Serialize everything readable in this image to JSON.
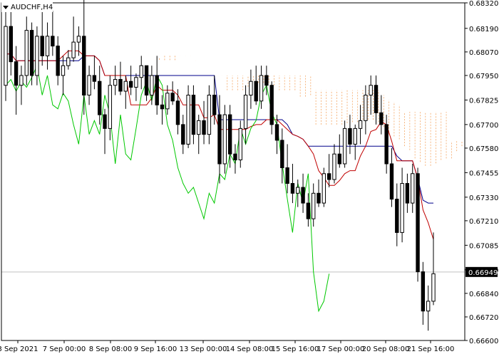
{
  "window": {
    "symbol_timeframe": "AUDCHF,H4"
  },
  "icons": {
    "symbol_menu": "triangle-down-icon"
  },
  "colors": {
    "background": "#ffffff",
    "frame": "#000000",
    "bull_candle": "#ffffff",
    "bear_candle": "#000000",
    "tenkan": "#c00000",
    "kijun": "#00008b",
    "chikou": "#00c800",
    "kumo_a": "#f4a460",
    "kumo_b": "#d8bfa0",
    "bid_line": "#c0c0c0",
    "price_tag_bg": "#000000",
    "price_tag_text": "#ffffff"
  },
  "price_tag": "0.66949",
  "chart_data": {
    "type": "candlestick",
    "title": "AUDCHF,H4",
    "ylim": [
      0.666,
      0.6832
    ],
    "y_ticks": [
      "0.68320",
      "0.68190",
      "0.68070",
      "0.67950",
      "0.67825",
      "0.67700",
      "0.67580",
      "0.67455",
      "0.67330",
      "0.67210",
      "0.67085",
      "0.66960",
      "0.66840",
      "0.66720",
      "0.66600"
    ],
    "x_ticks": [
      "3 Sep 2021",
      "7 Sep 00:00",
      "8 Sep 08:00",
      "9 Sep 16:00",
      "13 Sep 00:00",
      "14 Sep 08:00",
      "15 Sep 16:00",
      "17 Sep 00:00",
      "20 Sep 08:00",
      "21 Sep 16:00"
    ],
    "current_price": 0.66949,
    "candles": [
      [
        0.679,
        0.683,
        0.6782,
        0.682
      ],
      [
        0.682,
        0.6828,
        0.6795,
        0.6802
      ],
      [
        0.6802,
        0.681,
        0.6775,
        0.679
      ],
      [
        0.679,
        0.68,
        0.678,
        0.6795
      ],
      [
        0.6795,
        0.6825,
        0.679,
        0.6818
      ],
      [
        0.6818,
        0.6822,
        0.679,
        0.6795
      ],
      [
        0.6795,
        0.682,
        0.679,
        0.6815
      ],
      [
        0.6815,
        0.683,
        0.68,
        0.6805
      ],
      [
        0.6805,
        0.6822,
        0.6798,
        0.6815
      ],
      [
        0.6815,
        0.6828,
        0.6805,
        0.681
      ],
      [
        0.681,
        0.6815,
        0.679,
        0.6795
      ],
      [
        0.6795,
        0.6805,
        0.6785,
        0.68
      ],
      [
        0.68,
        0.6808,
        0.6798,
        0.6804
      ],
      [
        0.6804,
        0.6825,
        0.6802,
        0.6812
      ],
      [
        0.6812,
        0.682,
        0.6805,
        0.6815
      ],
      [
        0.6815,
        0.6835,
        0.6775,
        0.6785
      ],
      [
        0.6785,
        0.68,
        0.678,
        0.6795
      ],
      [
        0.6795,
        0.6805,
        0.6788,
        0.6792
      ],
      [
        0.6792,
        0.68,
        0.677,
        0.6775
      ],
      [
        0.6775,
        0.6778,
        0.6755,
        0.6768
      ],
      [
        0.6768,
        0.6795,
        0.6762,
        0.679
      ],
      [
        0.679,
        0.68,
        0.6785,
        0.6793
      ],
      [
        0.6793,
        0.6802,
        0.6785,
        0.6787
      ],
      [
        0.6787,
        0.6795,
        0.6778,
        0.6792
      ],
      [
        0.6792,
        0.68,
        0.6785,
        0.6789
      ],
      [
        0.6789,
        0.6796,
        0.6782,
        0.6794
      ],
      [
        0.6794,
        0.6805,
        0.6788,
        0.68
      ],
      [
        0.68,
        0.68,
        0.6782,
        0.6785
      ],
      [
        0.6785,
        0.68,
        0.678,
        0.6795
      ],
      [
        0.6795,
        0.6805,
        0.6775,
        0.678
      ],
      [
        0.678,
        0.6785,
        0.677,
        0.6778
      ],
      [
        0.6778,
        0.679,
        0.6775,
        0.6786
      ],
      [
        0.6786,
        0.6792,
        0.678,
        0.6782
      ],
      [
        0.6782,
        0.6788,
        0.6765,
        0.677
      ],
      [
        0.677,
        0.6775,
        0.6755,
        0.676
      ],
      [
        0.676,
        0.679,
        0.6758,
        0.6785
      ],
      [
        0.6785,
        0.679,
        0.676,
        0.6765
      ],
      [
        0.6765,
        0.6775,
        0.6755,
        0.6772
      ],
      [
        0.6772,
        0.6782,
        0.676,
        0.6765
      ],
      [
        0.6765,
        0.679,
        0.676,
        0.6785
      ],
      [
        0.6785,
        0.6795,
        0.677,
        0.6775
      ],
      [
        0.6775,
        0.6785,
        0.674,
        0.675
      ],
      [
        0.675,
        0.678,
        0.6745,
        0.6775
      ],
      [
        0.6775,
        0.678,
        0.6748,
        0.6755
      ],
      [
        0.6755,
        0.676,
        0.6745,
        0.6752
      ],
      [
        0.6752,
        0.6772,
        0.6748,
        0.6768
      ],
      [
        0.6768,
        0.679,
        0.676,
        0.6785
      ],
      [
        0.6785,
        0.6798,
        0.6778,
        0.6792
      ],
      [
        0.6792,
        0.68,
        0.678,
        0.6782
      ],
      [
        0.6782,
        0.68,
        0.6778,
        0.6795
      ],
      [
        0.6795,
        0.68,
        0.6785,
        0.679
      ],
      [
        0.679,
        0.6792,
        0.6765,
        0.677
      ],
      [
        0.677,
        0.6775,
        0.6755,
        0.6762
      ],
      [
        0.6762,
        0.6768,
        0.674,
        0.6748
      ],
      [
        0.6748,
        0.676,
        0.6735,
        0.674
      ],
      [
        0.674,
        0.675,
        0.673,
        0.6735
      ],
      [
        0.6735,
        0.6742,
        0.6728,
        0.6738
      ],
      [
        0.6738,
        0.6745,
        0.6725,
        0.673
      ],
      [
        0.673,
        0.6735,
        0.6718,
        0.6722
      ],
      [
        0.6722,
        0.674,
        0.6718,
        0.6735
      ],
      [
        0.6735,
        0.6742,
        0.6728,
        0.673
      ],
      [
        0.673,
        0.6748,
        0.6728,
        0.6745
      ],
      [
        0.6745,
        0.6755,
        0.6738,
        0.6742
      ],
      [
        0.6742,
        0.676,
        0.674,
        0.6755
      ],
      [
        0.6755,
        0.6765,
        0.6748,
        0.675
      ],
      [
        0.675,
        0.6772,
        0.6748,
        0.6768
      ],
      [
        0.6768,
        0.6775,
        0.6755,
        0.676
      ],
      [
        0.676,
        0.677,
        0.6752,
        0.6768
      ],
      [
        0.6768,
        0.678,
        0.676,
        0.6772
      ],
      [
        0.6772,
        0.679,
        0.6765,
        0.6785
      ],
      [
        0.6785,
        0.6795,
        0.6775,
        0.679
      ],
      [
        0.679,
        0.6795,
        0.677,
        0.6776
      ],
      [
        0.6776,
        0.6785,
        0.6765,
        0.677
      ],
      [
        0.677,
        0.6775,
        0.6745,
        0.675
      ],
      [
        0.675,
        0.6758,
        0.6728,
        0.6732
      ],
      [
        0.6732,
        0.674,
        0.6708,
        0.6715
      ],
      [
        0.6715,
        0.6748,
        0.671,
        0.674
      ],
      [
        0.674,
        0.6745,
        0.6725,
        0.673
      ],
      [
        0.673,
        0.675,
        0.6725,
        0.6745
      ],
      [
        0.6745,
        0.6748,
        0.669,
        0.6695
      ],
      [
        0.6695,
        0.67,
        0.6668,
        0.6675
      ],
      [
        0.6675,
        0.6688,
        0.6665,
        0.668
      ],
      [
        0.668,
        0.6715,
        0.6678,
        0.6694
      ]
    ]
  }
}
